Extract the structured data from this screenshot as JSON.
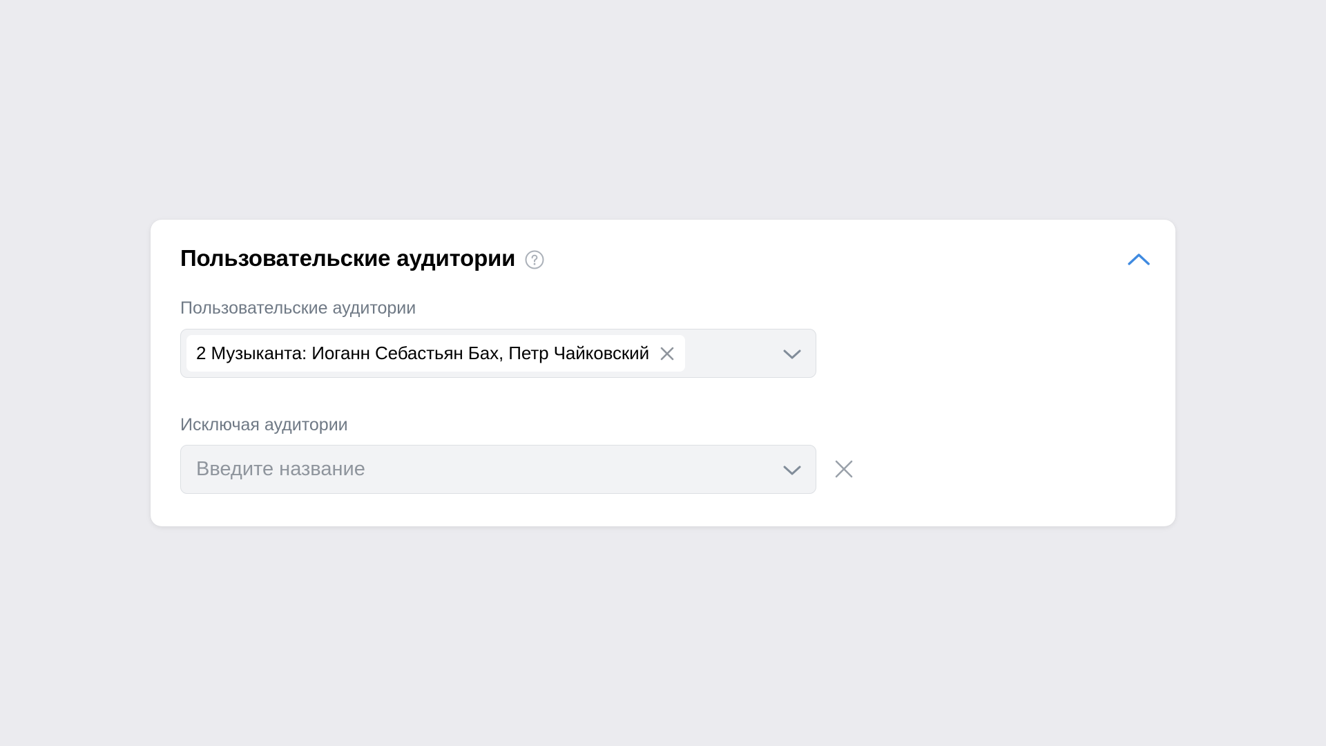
{
  "card": {
    "title": "Пользовательские аудитории",
    "help_icon": "question-circle-icon",
    "collapse_icon": "chevron-up-icon"
  },
  "include_field": {
    "label": "Пользовательские аудитории",
    "selected_chip": "2 Музыканта: Иоганн Себастьян Бах, Петр Чайковский",
    "chip_remove_icon": "close-icon",
    "dropdown_icon": "chevron-down-icon"
  },
  "exclude_field": {
    "label": "Исключая аудитории",
    "value": "",
    "placeholder": "Введите название",
    "dropdown_icon": "chevron-down-icon",
    "remove_icon": "close-icon"
  },
  "colors": {
    "background": "#ebebef",
    "card": "#ffffff",
    "accent": "#3f8ae0",
    "field_bg": "#f2f3f5",
    "label_text": "#6f7985",
    "placeholder_text": "#8f959d"
  }
}
